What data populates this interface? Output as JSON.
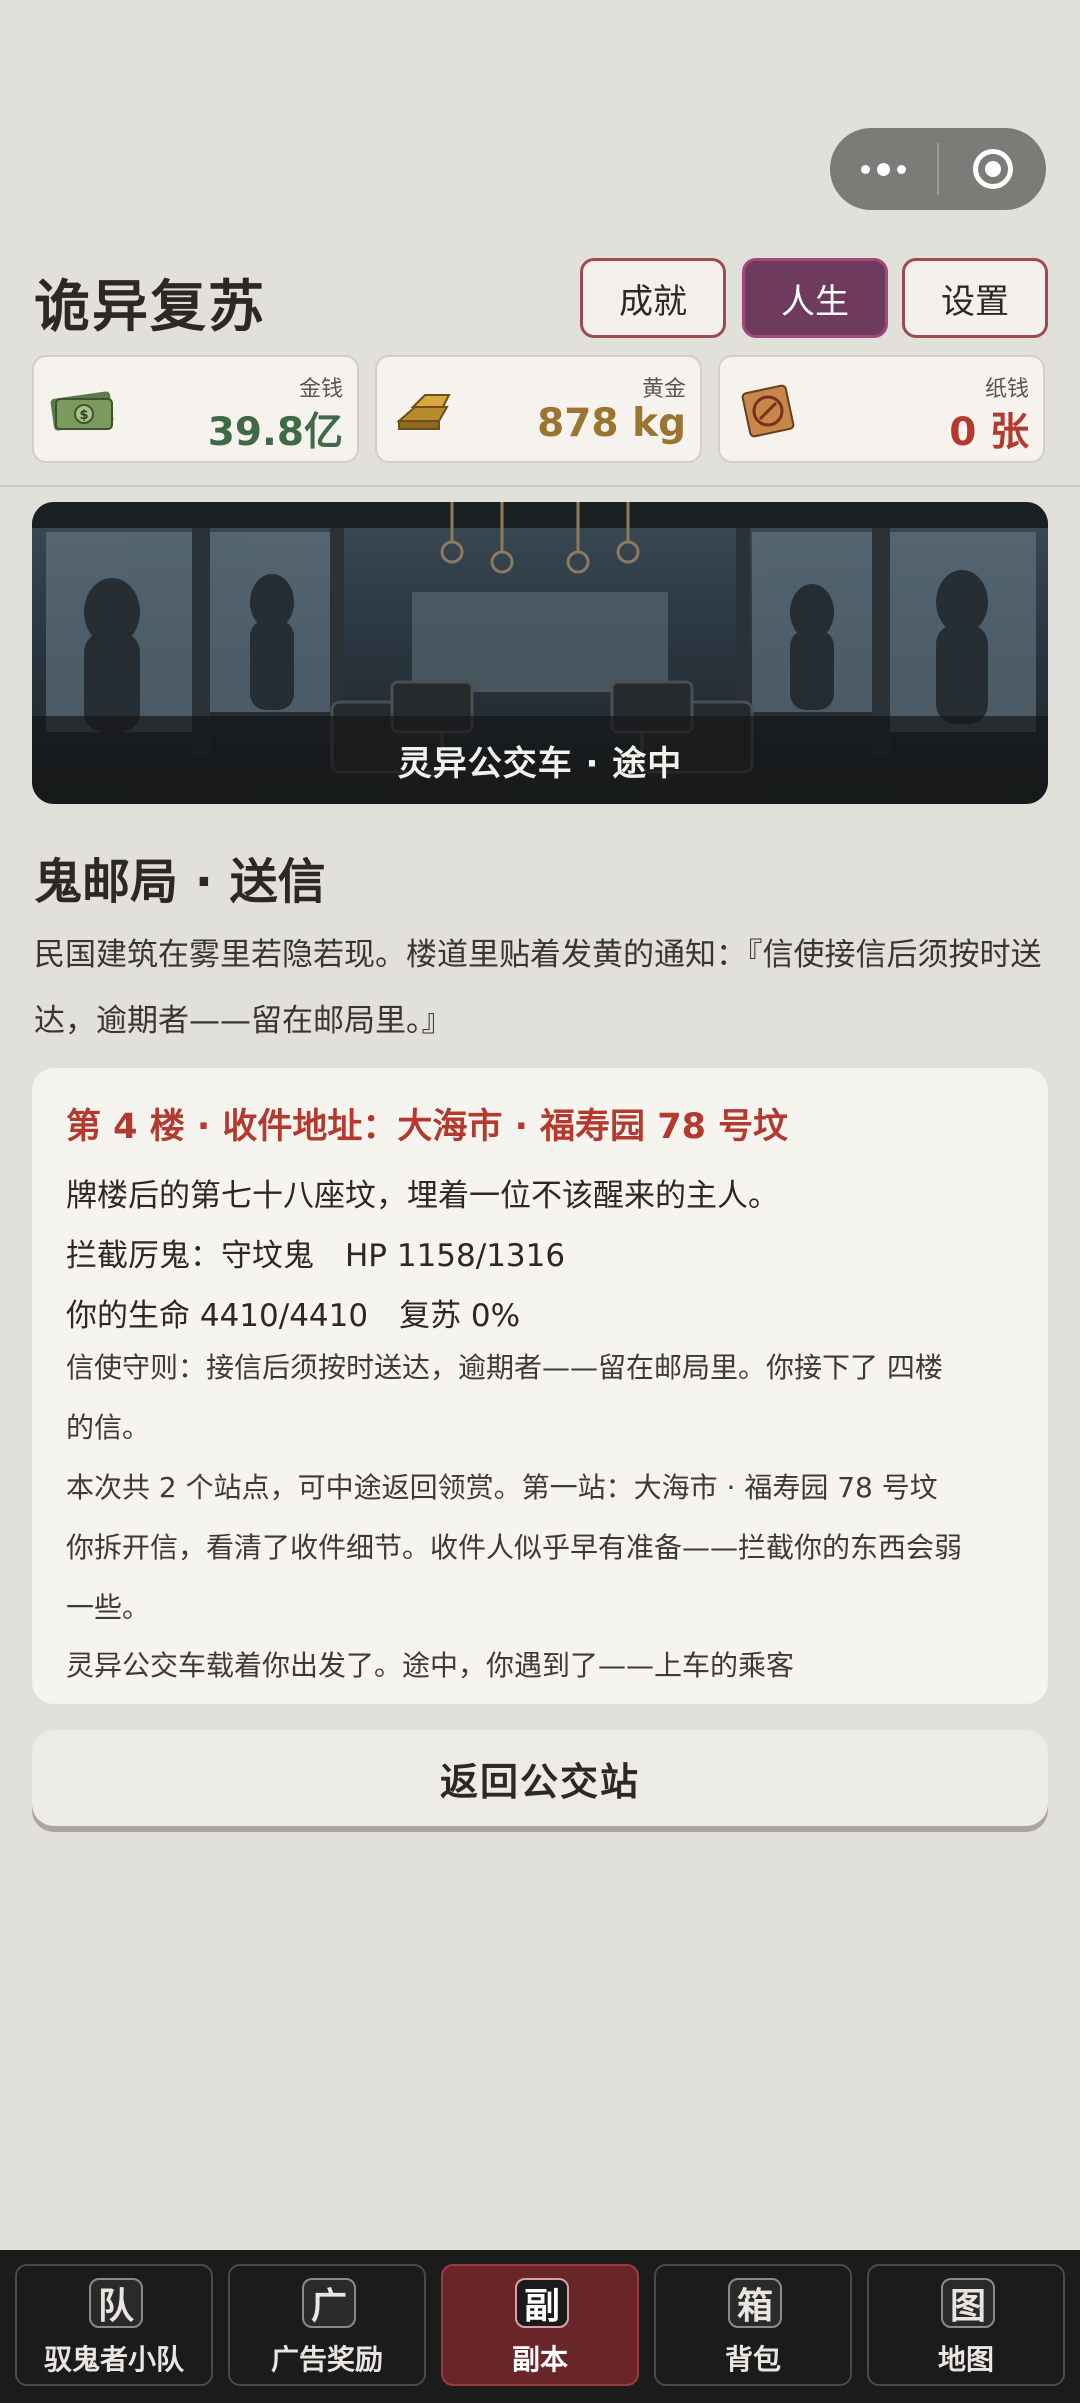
{
  "header": {
    "title": "诡异复苏",
    "buttons": [
      "成就",
      "人生",
      "设置"
    ],
    "active_button": "人生"
  },
  "currencies": [
    {
      "label": "金钱",
      "value": "39.8亿",
      "color": "#3f6a45",
      "icon": "money-icon"
    },
    {
      "label": "黄金",
      "value": "878 kg",
      "color": "#9a7430",
      "icon": "gold-bar-icon"
    },
    {
      "label": "纸钱",
      "value": "0 张",
      "color": "#b4392f",
      "icon": "paper-money-icon"
    }
  ],
  "banner": {
    "caption": "灵异公交车 · 途中"
  },
  "section": {
    "title": "鬼邮局 · 送信",
    "intro": "民国建筑在雾里若隐若现。楼道里贴着发黄的通知：『信使接信后须按时送达，逾期者——留在邮局里。』"
  },
  "card": {
    "headline": "第 4 楼 · 收件地址：大海市 · 福寿园 78 号坟",
    "line1": "牌楼后的第七十八座坟，埋着一位不该醒来的主人。",
    "line2": "拦截厉鬼：守坟鬼　HP 1158/1316",
    "line3": "你的生命 4410/4410　复苏 0%",
    "line4a": "信使守则：接信后须按时送达，逾期者——留在邮局里。你接下了 四楼",
    "line4b": "的信。",
    "line5": "本次共 2 个站点，可中途返回领赏。第一站：大海市 · 福寿园 78 号坟",
    "line6a": "你拆开信，看清了收件细节。收件人似乎早有准备——拦截你的东西会弱",
    "line6b": "一些。",
    "line7": "灵异公交车载着你出发了。途中，你遇到了——上车的乘客"
  },
  "back_button": "返回公交站",
  "nav": [
    {
      "glyph": "队",
      "label": "驭鬼者小队"
    },
    {
      "glyph": "广",
      "label": "广告奖励"
    },
    {
      "glyph": "副",
      "label": "副本"
    },
    {
      "glyph": "箱",
      "label": "背包"
    },
    {
      "glyph": "图",
      "label": "地图"
    }
  ],
  "active_tab": "副本"
}
